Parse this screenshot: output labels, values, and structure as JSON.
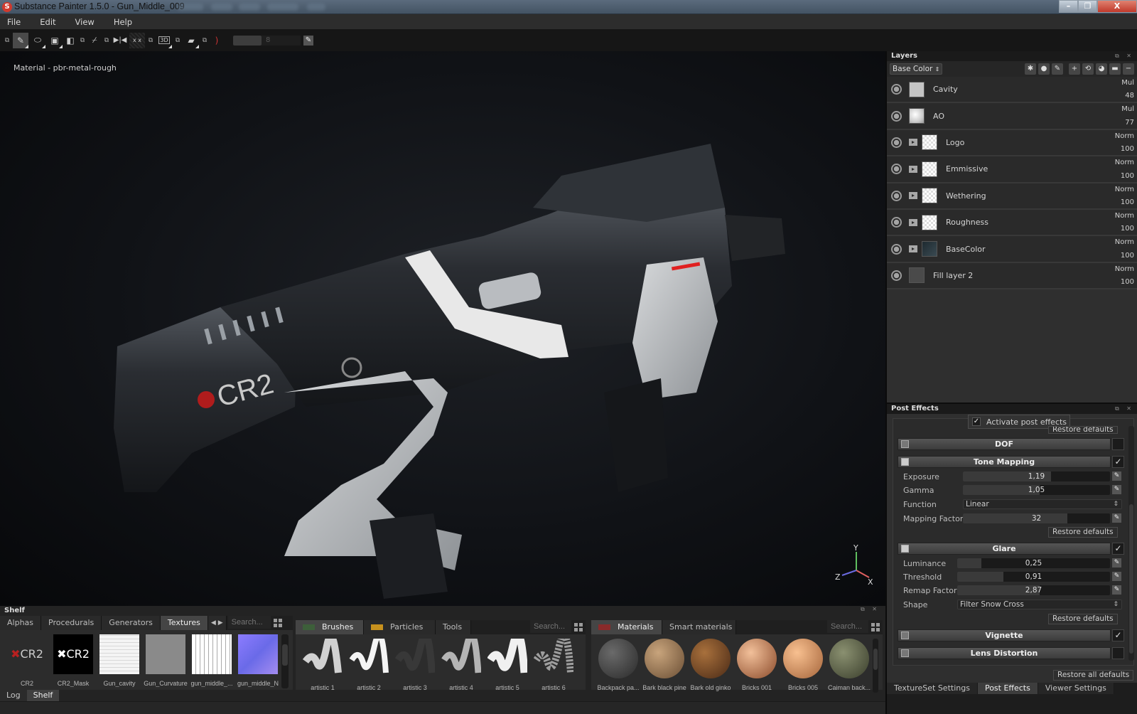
{
  "window": {
    "title": "Substance Painter 1.5.0 - Gun_Middle_009",
    "controls": {
      "minimize": "–",
      "maximize": "❐",
      "close": "X"
    }
  },
  "menu": [
    "File",
    "Edit",
    "View",
    "Help"
  ],
  "toolbar": {
    "tools": [
      "popout",
      "paint-brush",
      "eraser",
      "projection",
      "popout",
      "polygon-fill",
      "popout",
      "color-picker",
      "popout",
      "symmetry",
      "x-mirror",
      "popout",
      "3d-view",
      "popout",
      "camera",
      "popout",
      "lazy-mouse"
    ],
    "brush_size_value": "8"
  },
  "viewport": {
    "material_label": "Material - pbr-metal-rough",
    "logo_text": "CR2",
    "gizmo": {
      "x": "X",
      "y": "Y",
      "z": "Z"
    },
    "colors": {
      "x_axis": "#e06060",
      "y_axis": "#5fbf5f",
      "z_axis": "#6a6ae0"
    }
  },
  "shelf": {
    "title": "Shelf",
    "textures": {
      "tabs": [
        "Alphas",
        "Procedurals",
        "Generators",
        "Textures"
      ],
      "active_tab": "Textures",
      "search_placeholder": "Search...",
      "items": [
        "CR2",
        "CR2_Mask",
        "Gun_cavity",
        "Gun_Curvature",
        "gun_middle_...",
        "gun_middle_N"
      ]
    },
    "brushes": {
      "tabs": [
        "Brushes",
        "Particles",
        "Tools"
      ],
      "active_tab": "Brushes",
      "tab_colors": {
        "Brushes": "#3d5f3a",
        "Particles": "#c8921e"
      },
      "search_placeholder": "Search...",
      "items": [
        "artistic 1",
        "artistic 2",
        "artistic 3",
        "artistic 4",
        "artistic 5",
        "artistic 6"
      ]
    },
    "materials": {
      "tabs": [
        "Materials",
        "Smart materials"
      ],
      "active_tab": "Materials",
      "tab_colors": {
        "Materials": "#8a2a2a"
      },
      "search_placeholder": "Search...",
      "items": [
        "Backpack pa...",
        "Bark black pine",
        "Bark old ginko",
        "Bricks 001",
        "Bricks 005",
        "Caiman back..."
      ]
    },
    "bottom_tabs": [
      "Log",
      "Shelf"
    ],
    "active_bottom_tab": "Shelf"
  },
  "layers": {
    "title": "Layers",
    "channel": "Base Color",
    "items": [
      {
        "name": "Cavity",
        "blend": "Mul",
        "opacity": "48",
        "folder": false,
        "thumb": "gray"
      },
      {
        "name": "AO",
        "blend": "Mul",
        "opacity": "77",
        "folder": false,
        "thumb": "ao"
      },
      {
        "name": "Logo",
        "blend": "Norm",
        "opacity": "100",
        "folder": true,
        "thumb": "checker"
      },
      {
        "name": "Emmissive",
        "blend": "Norm",
        "opacity": "100",
        "folder": true,
        "thumb": "checker"
      },
      {
        "name": "Wethering",
        "blend": "Norm",
        "opacity": "100",
        "folder": true,
        "thumb": "checker"
      },
      {
        "name": "Roughness",
        "blend": "Norm",
        "opacity": "100",
        "folder": true,
        "thumb": "checker"
      },
      {
        "name": "BaseColor",
        "blend": "Norm",
        "opacity": "100",
        "folder": true,
        "thumb": "dark"
      },
      {
        "name": "Fill layer 2",
        "blend": "Norm",
        "opacity": "100",
        "folder": false,
        "thumb": "fill"
      }
    ]
  },
  "post_effects": {
    "title": "Post Effects",
    "activate_label": "Activate post effects",
    "activate_checked": true,
    "restore_label": "Restore defaults",
    "restore_all_label": "Restore all defaults",
    "sections": {
      "dof": {
        "label": "DOF",
        "enabled": false
      },
      "tone_mapping": {
        "label": "Tone Mapping",
        "enabled": true,
        "exposure": {
          "label": "Exposure",
          "value": "1,19",
          "fraction": 0.6
        },
        "gamma": {
          "label": "Gamma",
          "value": "1,05",
          "fraction": 0.52
        },
        "function": {
          "label": "Function",
          "value": "Linear"
        },
        "mapping_factor": {
          "label": "Mapping Factor",
          "value": "32",
          "fraction": 0.71
        }
      },
      "glare": {
        "label": "Glare",
        "enabled": true,
        "luminance": {
          "label": "Luminance",
          "value": "0,25",
          "fraction": 0.16
        },
        "threshold": {
          "label": "Threshold",
          "value": "0,91",
          "fraction": 0.3
        },
        "remap_factor": {
          "label": "Remap Factor",
          "value": "2,87",
          "fraction": 0.54
        },
        "shape": {
          "label": "Shape",
          "value": "Filter Snow Cross"
        }
      },
      "vignette": {
        "label": "Vignette",
        "enabled": true
      },
      "lens_distortion": {
        "label": "Lens Distortion",
        "enabled": false
      }
    }
  },
  "right_tabs": [
    "TextureSet Settings",
    "Post Effects",
    "Viewer Settings"
  ],
  "active_right_tab": "Post Effects"
}
